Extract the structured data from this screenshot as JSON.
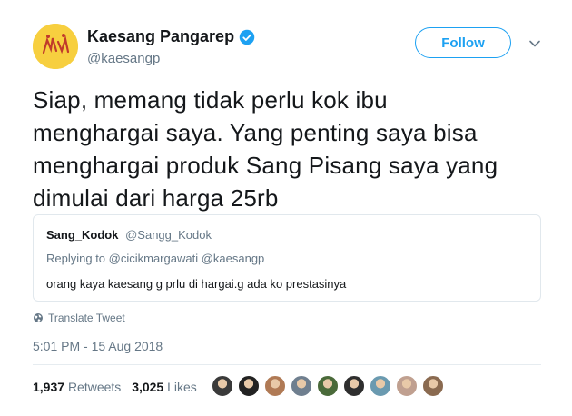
{
  "author": {
    "display_name": "Kaesang Pangarep",
    "handle": "@kaesangp",
    "verified": true,
    "avatar_color": "#f7cf3f"
  },
  "follow_label": "Follow",
  "tweet": {
    "lines": [
      "Siap, memang tidak perlu kok ibu",
      "menghargai saya. Yang penting saya bisa",
      "menghargai produk Sang Pisang saya yang",
      "dimulai dari harga 25rb"
    ]
  },
  "quoted": {
    "name": "Sang_Kodok",
    "handle": "@Sangg_Kodok",
    "replying_to": "Replying to @cicikmargawati @kaesangp",
    "text": "orang kaya kaesang g prlu di hargai.g ada ko prestasinya"
  },
  "translate_label": "Translate Tweet",
  "timestamp": "5:01 PM - 15 Aug 2018",
  "stats": {
    "retweets_count": "1,937",
    "retweets_label": "Retweets",
    "likes_count": "3,025",
    "likes_label": "Likes"
  },
  "likers": [
    {
      "color": "#3a3a3a"
    },
    {
      "color": "#222222"
    },
    {
      "color": "#b07a55"
    },
    {
      "color": "#6f7f8f"
    },
    {
      "color": "#4a6a3a"
    },
    {
      "color": "#2e2e2e"
    },
    {
      "color": "#6a9ab0"
    },
    {
      "color": "#c0a090"
    },
    {
      "color": "#8a6a50"
    }
  ],
  "colors": {
    "accent": "#1da1f2",
    "secondary_text": "#657786",
    "primary_text": "#14171a"
  }
}
